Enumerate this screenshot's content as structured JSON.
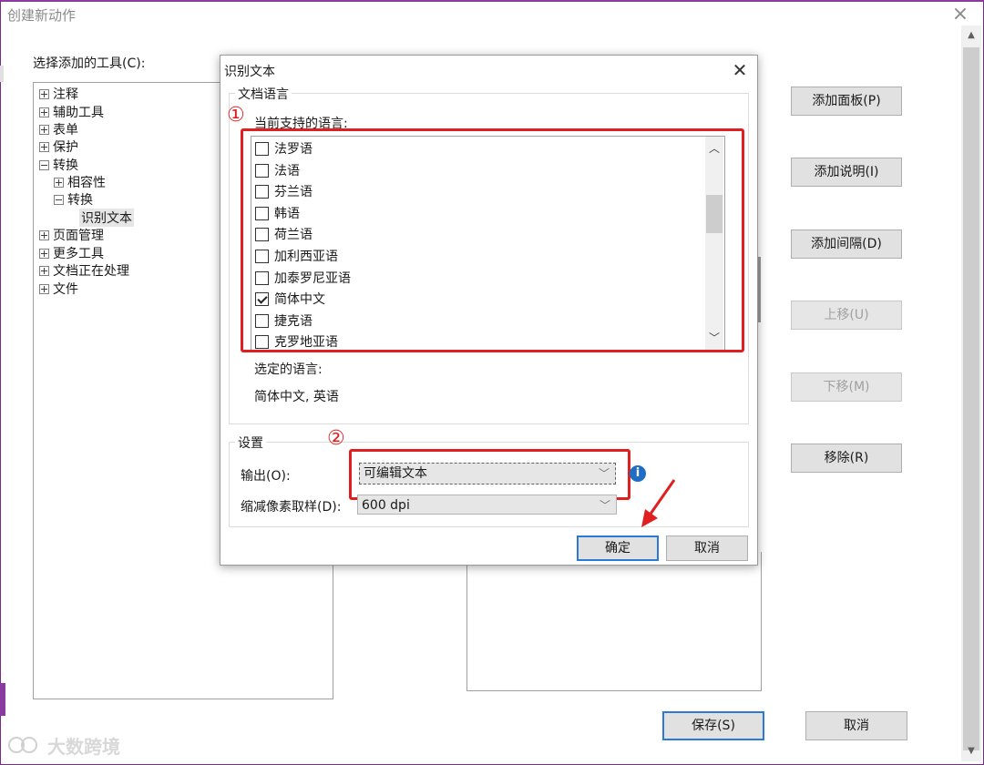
{
  "window": {
    "title": "创建新动作",
    "close": "×",
    "tools_label": "选择添加的工具(C):",
    "tree": [
      {
        "label": "注释",
        "state": "collapsed",
        "level": 0
      },
      {
        "label": "辅助工具",
        "state": "collapsed",
        "level": 0
      },
      {
        "label": "表单",
        "state": "collapsed",
        "level": 0
      },
      {
        "label": "保护",
        "state": "collapsed",
        "level": 0
      },
      {
        "label": "转换",
        "state": "expanded",
        "level": 0
      },
      {
        "label": "相容性",
        "state": "collapsed",
        "level": 1
      },
      {
        "label": "转换",
        "state": "expanded",
        "level": 1
      },
      {
        "label": "识别文本",
        "state": "leaf",
        "level": 2
      },
      {
        "label": "页面管理",
        "state": "collapsed",
        "level": 0
      },
      {
        "label": "更多工具",
        "state": "collapsed",
        "level": 0
      },
      {
        "label": "文档正在处理",
        "state": "collapsed",
        "level": 0
      },
      {
        "label": "文件",
        "state": "collapsed",
        "level": 0
      }
    ],
    "side_buttons": {
      "add_panel": "添加面板(P)",
      "add_note": "添加说明(I)",
      "add_separator": "添加间隔(D)",
      "move_up": "上移(U)",
      "move_down": "下移(M)",
      "remove": "移除(R)"
    },
    "save": "保存(S)",
    "cancel": "取消"
  },
  "dialog": {
    "title": "识别文本",
    "close": "✕",
    "doc_lang_group": "文档语言",
    "supported_label": "当前支持的语言:",
    "languages": [
      {
        "name": "法罗语",
        "checked": false
      },
      {
        "name": "法语",
        "checked": false
      },
      {
        "name": "芬兰语",
        "checked": false
      },
      {
        "name": "韩语",
        "checked": false
      },
      {
        "name": "荷兰语",
        "checked": false
      },
      {
        "name": "加利西亚语",
        "checked": false
      },
      {
        "name": "加泰罗尼亚语",
        "checked": false
      },
      {
        "name": "简体中文",
        "checked": true
      },
      {
        "name": "捷克语",
        "checked": false
      },
      {
        "name": "克罗地亚语",
        "checked": false
      }
    ],
    "selected_label": "选定的语言:",
    "selected_value": "简体中文, 英语",
    "settings_group": "设置",
    "output_label": "输出(O):",
    "output_value": "可编辑文本",
    "downsample_label": "缩减像素取样(D):",
    "downsample_value": "600 dpi",
    "ok": "确定",
    "cancel": "取消",
    "annotation_1": "①",
    "annotation_2": "②"
  },
  "watermark": "大数跨境",
  "colors": {
    "annotation_red": "#e02020",
    "accent_blue": "#2a7ad6",
    "window_border": "#8a3aa0"
  }
}
